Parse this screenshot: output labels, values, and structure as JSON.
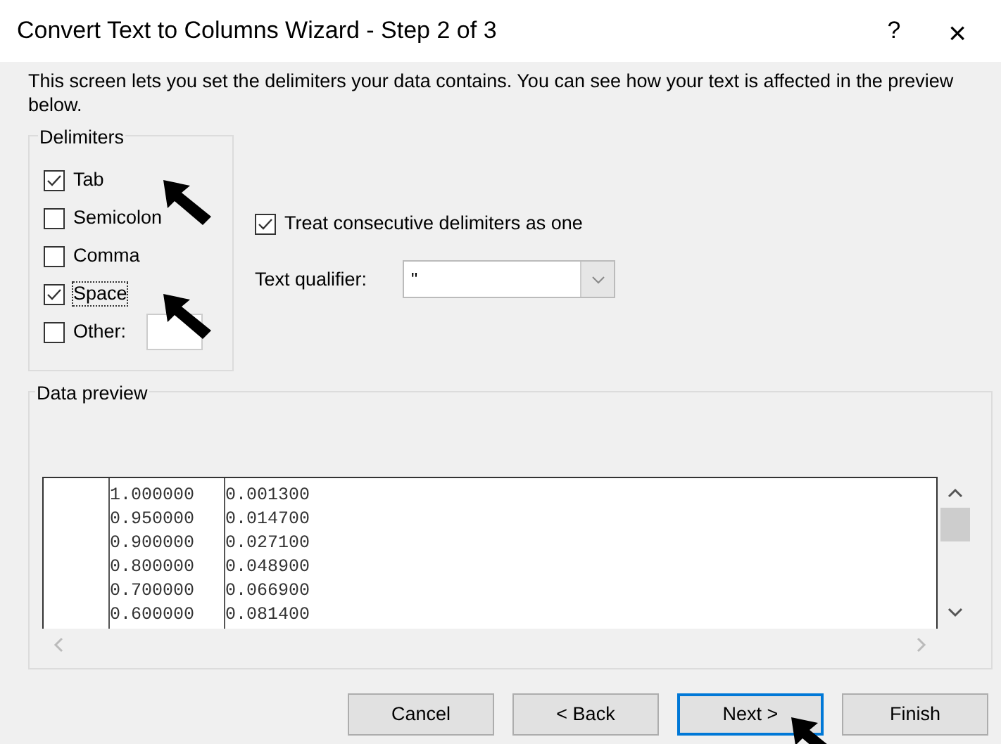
{
  "window": {
    "title": "Convert Text to Columns Wizard - Step 2 of 3",
    "help": "?",
    "close": "×"
  },
  "description": "This screen lets you set the delimiters your data contains.  You can see how your text is affected in the preview below.",
  "delimiters": {
    "title": "Delimiters",
    "items": [
      {
        "label": "Tab",
        "checked": true,
        "focused": false,
        "kind": "checkbox",
        "arrow": true
      },
      {
        "label": "Semicolon",
        "checked": false,
        "focused": false,
        "kind": "checkbox"
      },
      {
        "label": "Comma",
        "checked": false,
        "focused": false,
        "kind": "checkbox"
      },
      {
        "label": "Space",
        "checked": true,
        "focused": true,
        "kind": "checkbox",
        "arrow": true
      },
      {
        "label": "Other:",
        "checked": false,
        "focused": false,
        "kind": "other"
      }
    ]
  },
  "consecutive": {
    "label": "Treat consecutive delimiters as one",
    "checked": true
  },
  "text_qualifier": {
    "label": "Text qualifier:",
    "value": "\""
  },
  "data_preview": {
    "title": "Data preview",
    "rows": [
      [
        "1.000000",
        "0.001300"
      ],
      [
        "0.950000",
        "0.014700"
      ],
      [
        "0.900000",
        "0.027100"
      ],
      [
        "0.800000",
        "0.048900"
      ],
      [
        "0.700000",
        "0.066900"
      ],
      [
        "0.600000",
        "0.081400"
      ]
    ]
  },
  "buttons": [
    {
      "label": "Cancel",
      "selected": false
    },
    {
      "label": "< Back",
      "selected": false
    },
    {
      "label": "Next >",
      "selected": true,
      "arrow": true
    },
    {
      "label": "Finish",
      "selected": false
    }
  ]
}
